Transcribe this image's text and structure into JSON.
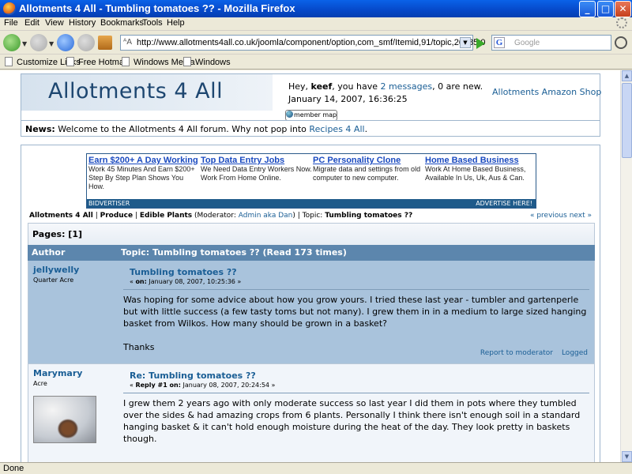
{
  "window": {
    "title": "Allotments 4 All - Tumbling tomatoes ?? - Mozilla Firefox",
    "buttons": {
      "minimize": "_",
      "maximize": "□",
      "close": "✕"
    }
  },
  "menu": [
    "File",
    "Edit",
    "View",
    "History",
    "Bookmarks",
    "Tools",
    "Help"
  ],
  "nav": {
    "url": "http://www.allotments4all.co.uk/joomla/component/option,com_smf/Itemid,91/topic,26985.0",
    "search_placeholder": "Google",
    "search_engine_glyph": "G"
  },
  "bookmarks": [
    "Customize Links",
    "Free Hotmail",
    "Windows Media",
    "Windows"
  ],
  "status": "Done",
  "header": {
    "logo": "Allotments 4 All",
    "hey_prefix": "Hey, ",
    "username": "keef",
    "hey_mid": ", you have ",
    "messages_link": "2 messages",
    "hey_suffix": ", 0 are new.",
    "datetime": "January 14, 2007, 16:36:25",
    "shop_link": "Allotments Amazon Shop",
    "member_map": "member map",
    "news_label": "News:",
    "news_text": " Welcome to the Allotments 4 All forum. Why not pop into ",
    "news_link": "Recipes 4 All",
    "news_end": "."
  },
  "ads": {
    "items": [
      {
        "title": "Earn $200+ A Day Working",
        "text": "Work 45 Minutes And Earn $200+ Step By Step Plan Shows You How."
      },
      {
        "title": "Top Data Entry Jobs",
        "text": "We Need Data Entry Workers Now. Work From Home Online."
      },
      {
        "title": "PC Personality Clone",
        "text": "Migrate data and settings from old computer to new computer."
      },
      {
        "title": "Home Based Business",
        "text": "Work At Home Based Business, Available In Us, Uk, Aus & Can."
      }
    ],
    "footer_left": "BIDVERTISER",
    "footer_right": "ADVERTISE HERE!"
  },
  "breadcrumb": {
    "c1": "Allotments 4 All",
    "sep": " | ",
    "c2": "Produce",
    "c3": "Edible Plants",
    "mod_prefix": " (Moderator: ",
    "moderator": "Admin aka Dan",
    "mod_suffix": ")",
    "topic_prefix": "Topic: ",
    "topic": "Tumbling tomatoes ??",
    "prev": "« previous",
    "next": "next »"
  },
  "pages": "Pages: [1]",
  "table_header": {
    "author": "Author",
    "topic": "Topic: Tumbling tomatoes ??  (Read 173 times)"
  },
  "posts": [
    {
      "author": "jellywelly",
      "rank": "Quarter Acre",
      "title": "Tumbling tomatoes ??",
      "meta_prefix": "« ",
      "meta_on": "on:",
      "meta_date": " January 08, 2007, 10:25:36 »",
      "body": "Was hoping for some advice about how you grow yours.  I tried these last year - tumbler and gartenperle but with little success (a few tasty toms but not many).  I grew them in in a medium to large sized hanging basket from Wilkos.  How many should be grown in a  basket?",
      "body2": "Thanks",
      "report": "Report to moderator",
      "logged": "Logged"
    },
    {
      "author": "Marymary",
      "rank": "Acre",
      "title": "Re: Tumbling tomatoes ??",
      "meta_prefix": "« ",
      "meta_on": "Reply #1 on:",
      "meta_date": " January 08, 2007, 20:24:54 »",
      "body": "I grew them 2 years ago with only moderate success so last year I did them in pots where they tumbled over the sides & had amazing crops from 6 plants.  Personally I think there isn't enough soil in a standard hanging basket & it can't hold enough moisture during the heat of the day.  They look pretty in baskets though."
    }
  ]
}
